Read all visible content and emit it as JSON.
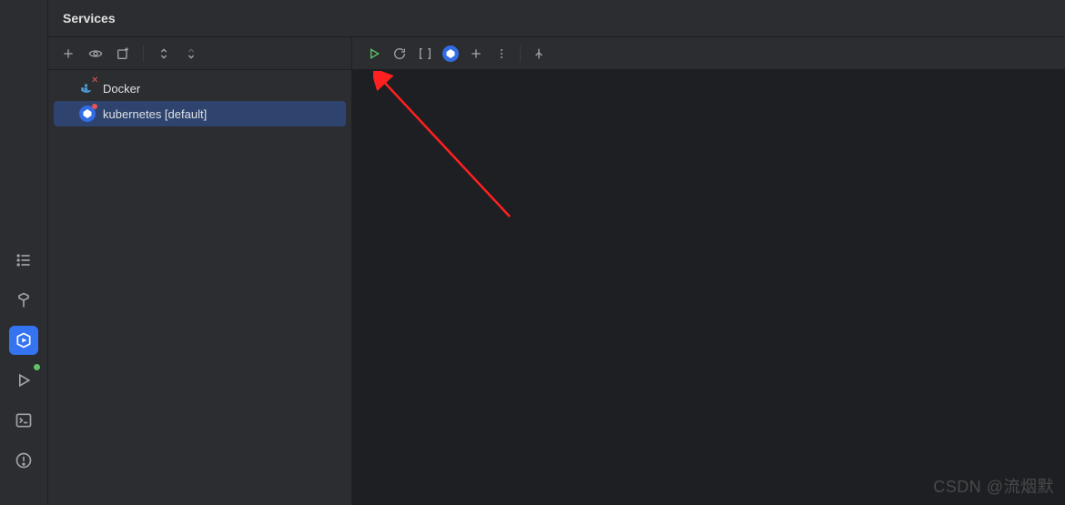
{
  "panel": {
    "title": "Services"
  },
  "tree": {
    "items": [
      {
        "label": "Docker"
      },
      {
        "label": "kubernetes [default]"
      }
    ]
  },
  "watermark": "CSDN @流烟默"
}
